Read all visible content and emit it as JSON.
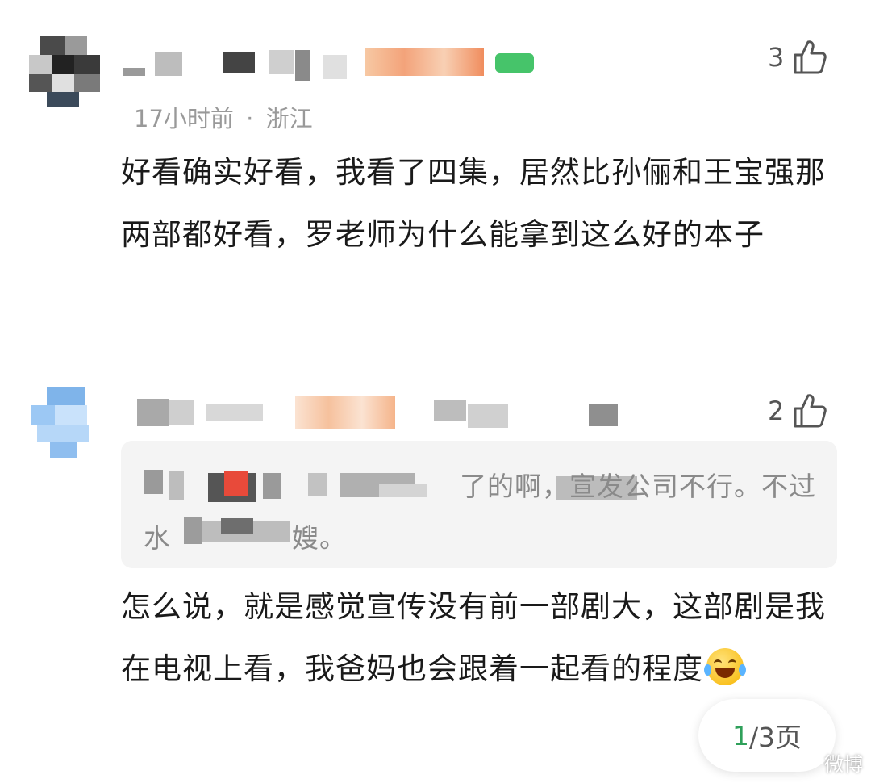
{
  "comments": [
    {
      "likes": "3",
      "time": "17小时前",
      "location": "浙江",
      "separator": "·",
      "text": "好看确实好看，我看了四集，居然比孙俪和王宝强那两部都好看，罗老师为什么能拿到这么好的本子"
    },
    {
      "likes": "2",
      "quote_line1_visible": "了的啊，宣发公司不行。不过",
      "quote_line2_start": "水",
      "quote_line2_end": "嫂。",
      "text": "怎么说，就是感觉宣传没有前一部剧大，这部剧是我在电视上看，我爸妈也会跟着一起看的程度"
    }
  ],
  "pager": {
    "current": "1",
    "total": "/3页"
  },
  "watermark": "微博",
  "colors": {
    "text": "#1a1a1a",
    "meta": "#999999",
    "quote_bg": "#f4f4f4",
    "pager_current": "#2fa05a"
  },
  "icons": [
    "thumb-up-icon",
    "laugh-cry-emoji"
  ]
}
